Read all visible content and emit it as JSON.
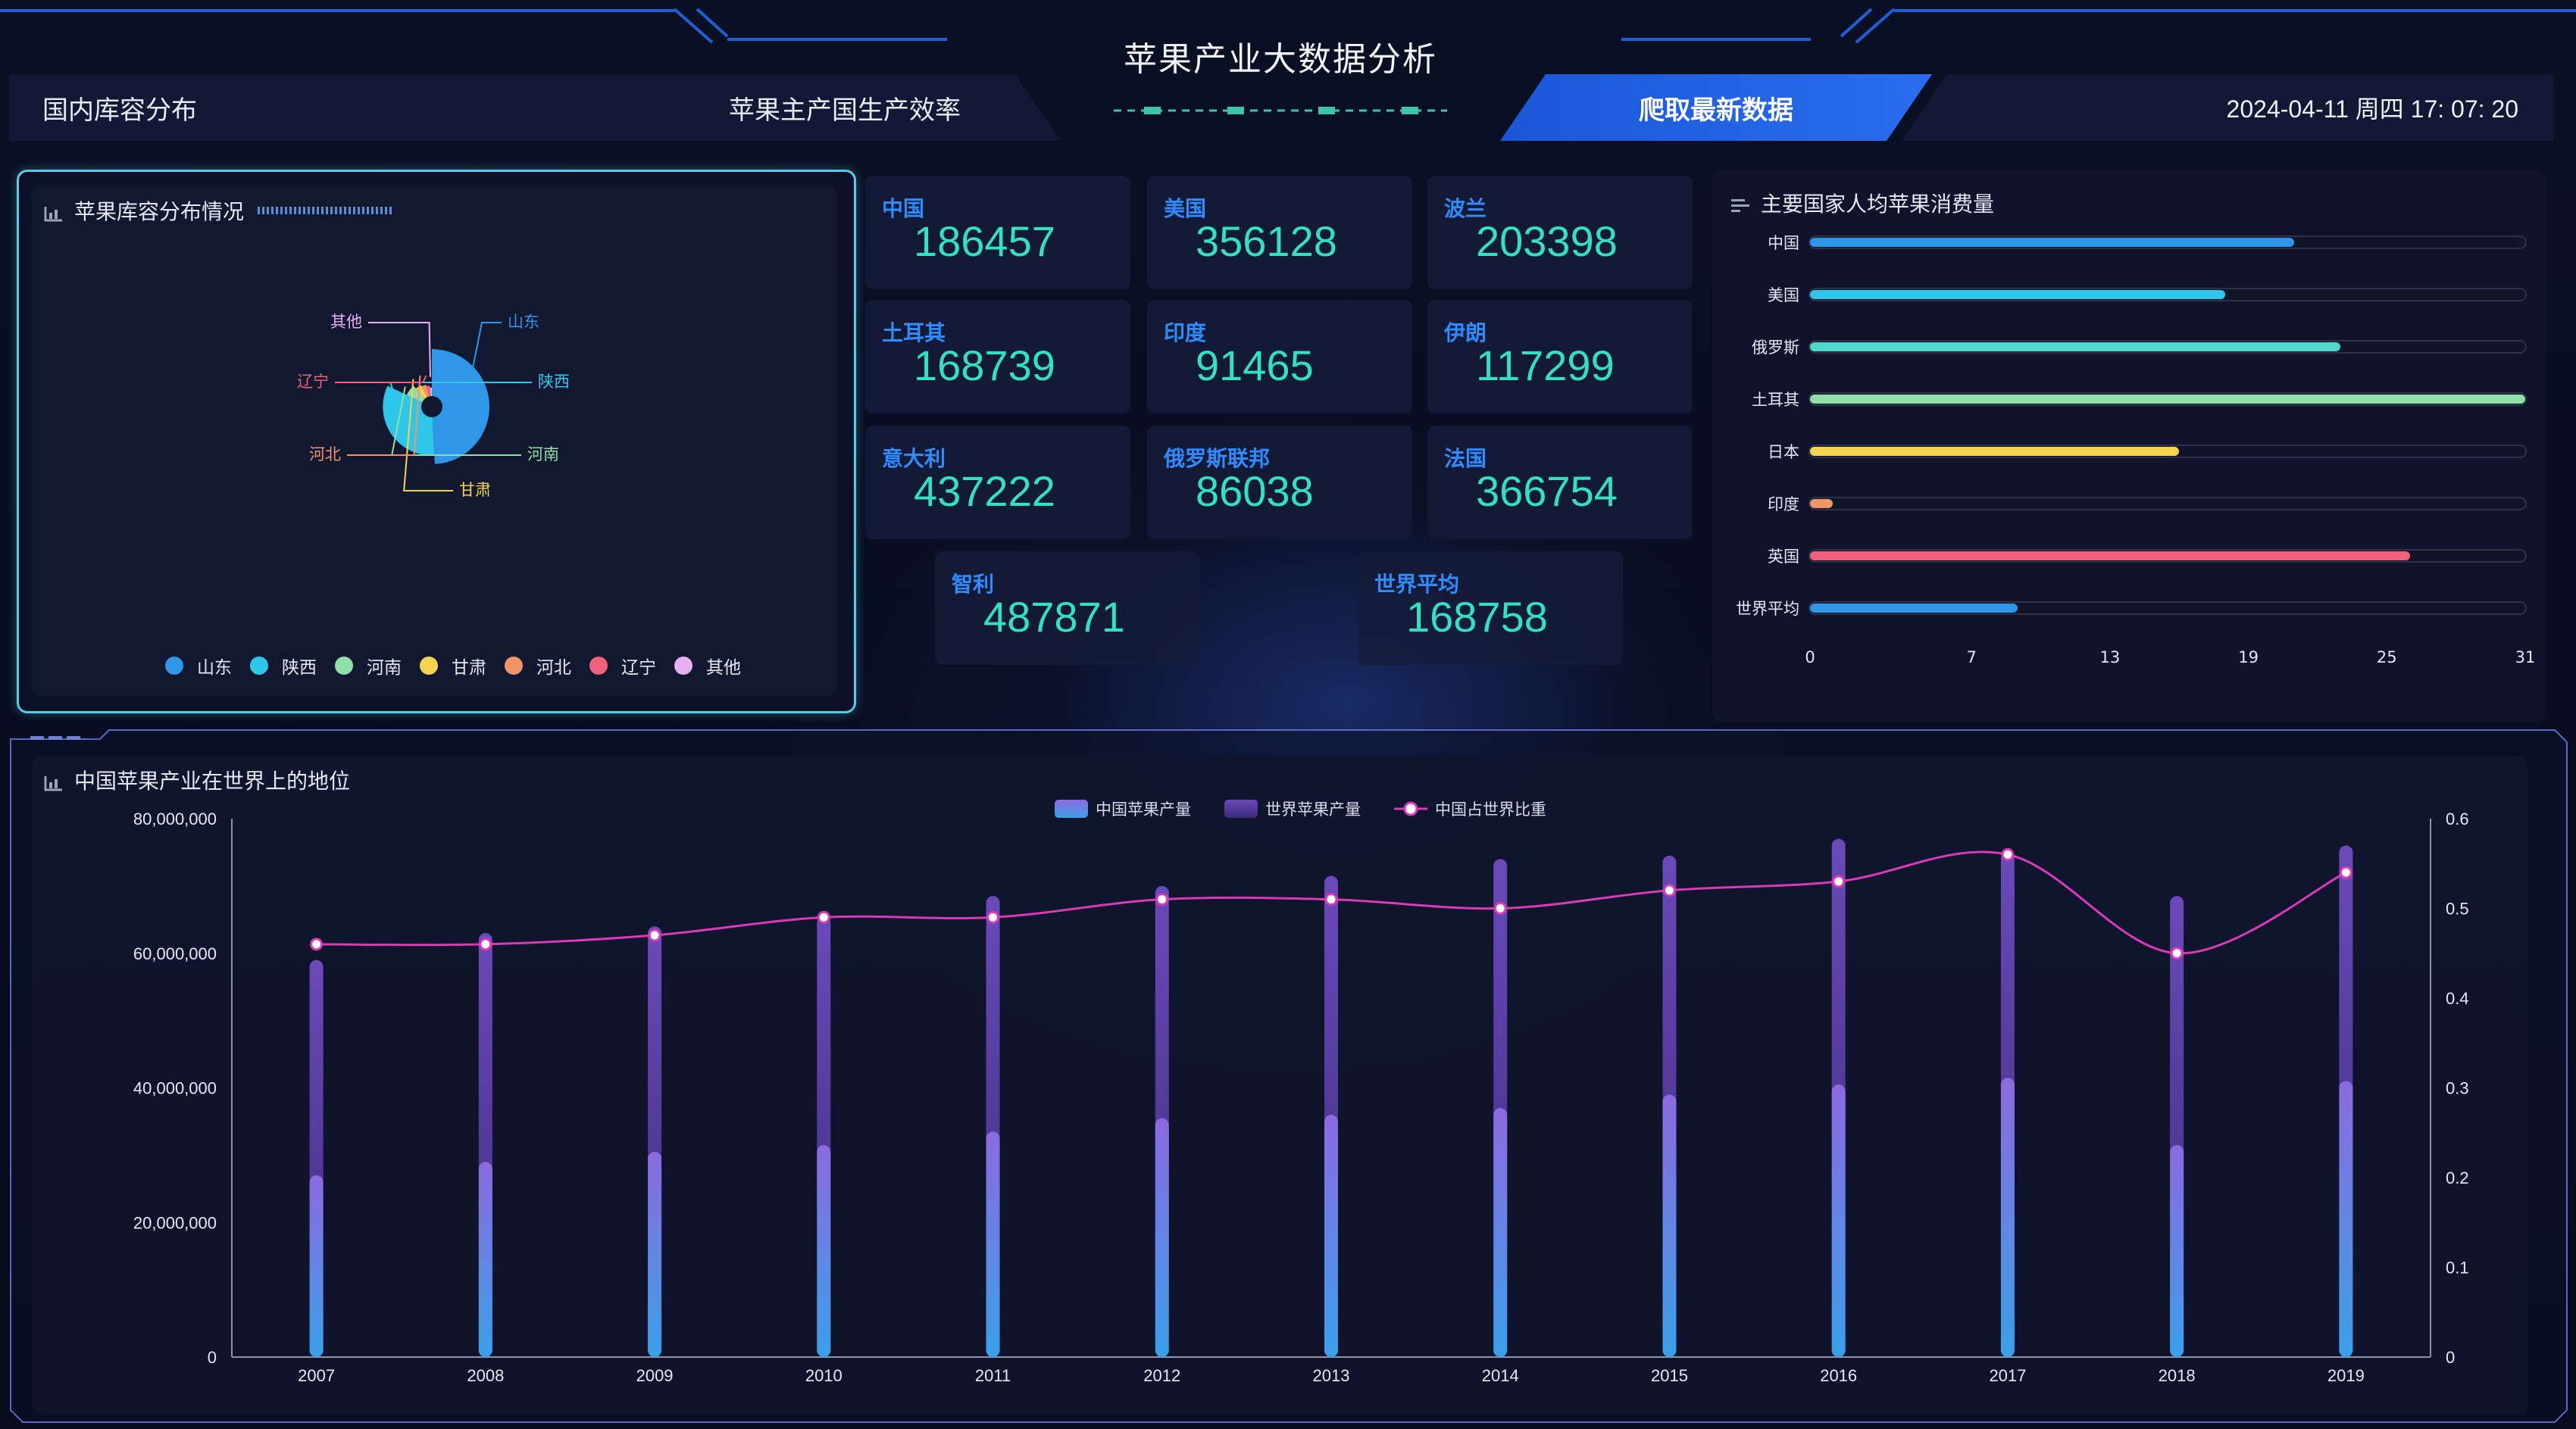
{
  "header": {
    "title": "苹果产业大数据分析",
    "tabs": [
      {
        "label": "国内库容分布"
      },
      {
        "label": "苹果主产国生产效率"
      },
      {
        "label": "爬取最新数据"
      }
    ],
    "datetime": "2024-04-11 周四 17: 07: 20"
  },
  "colors": {
    "accent": "#1e5fd8",
    "stat_value": "#33e0c0",
    "stat_label": "#2f8cff"
  },
  "inventory_panel": {
    "title": "苹果库容分布情况",
    "chart_data": {
      "type": "pie",
      "categories": [
        "山东",
        "陕西",
        "河南",
        "甘肃",
        "河北",
        "辽宁",
        "其他"
      ],
      "values": [
        60,
        40,
        8,
        5,
        4,
        3,
        2
      ],
      "colors": [
        "#2f96e8",
        "#2fc6ea",
        "#8fe0a8",
        "#f4d350",
        "#f0956a",
        "#f0607a",
        "#e7b0f0"
      ],
      "legend_position": "bottom"
    }
  },
  "stats": [
    {
      "label": "中国",
      "value": "186457"
    },
    {
      "label": "美国",
      "value": "356128"
    },
    {
      "label": "波兰",
      "value": "203398"
    },
    {
      "label": "土耳其",
      "value": "168739"
    },
    {
      "label": "印度",
      "value": "91465"
    },
    {
      "label": "伊朗",
      "value": "117299"
    },
    {
      "label": "意大利",
      "value": "437222"
    },
    {
      "label": "俄罗斯联邦",
      "value": "86038"
    },
    {
      "label": "法国",
      "value": "366754"
    },
    {
      "label": "智利",
      "value": "487871"
    },
    {
      "label": "世界平均",
      "value": "168758"
    }
  ],
  "consumption_panel": {
    "title": "主要国家人均苹果消费量",
    "chart_data": {
      "type": "bar",
      "orientation": "horizontal",
      "categories": [
        "中国",
        "美国",
        "俄罗斯",
        "土耳其",
        "日本",
        "印度",
        "英国",
        "世界平均"
      ],
      "values": [
        21,
        18,
        23,
        31,
        16,
        1,
        26,
        9
      ],
      "colors": [
        "#2f96e8",
        "#2fc6ea",
        "#4fd8c8",
        "#8fe0a8",
        "#f4d350",
        "#f0956a",
        "#f0607a",
        "#2f96e8"
      ],
      "xlim": [
        0,
        31
      ],
      "xticks": [
        "0",
        "7",
        "13",
        "19",
        "25",
        "31"
      ]
    }
  },
  "world_panel": {
    "title": "中国苹果产业在世界上的地位",
    "chart_data": {
      "type": "bar",
      "categories": [
        "2007",
        "2008",
        "2009",
        "2010",
        "2011",
        "2012",
        "2013",
        "2014",
        "2015",
        "2016",
        "2017",
        "2018",
        "2019"
      ],
      "series": [
        {
          "name": "中国苹果产量",
          "type": "bar",
          "values": [
            27000000,
            29000000,
            30500000,
            31500000,
            33500000,
            35500000,
            36000000,
            37000000,
            39000000,
            40500000,
            41500000,
            31500000,
            41000000
          ]
        },
        {
          "name": "世界苹果产量",
          "type": "bar",
          "values": [
            59000000,
            63000000,
            64000000,
            65500000,
            68500000,
            70000000,
            71500000,
            74000000,
            74500000,
            77000000,
            75000000,
            68500000,
            76000000
          ]
        },
        {
          "name": "中国占世界比重",
          "type": "line",
          "axis": "right",
          "values": [
            0.46,
            0.46,
            0.47,
            0.49,
            0.49,
            0.51,
            0.51,
            0.5,
            0.52,
            0.53,
            0.56,
            0.45,
            0.54
          ]
        }
      ],
      "ylim": [
        0,
        80000000
      ],
      "yticks": [
        "0",
        "20,000,000",
        "40,000,000",
        "60,000,000",
        "80,000,000"
      ],
      "y2lim": [
        0,
        0.6
      ],
      "y2ticks": [
        "0",
        "0.1",
        "0.2",
        "0.3",
        "0.4",
        "0.5",
        "0.6"
      ],
      "legend_position": "top-center"
    }
  }
}
